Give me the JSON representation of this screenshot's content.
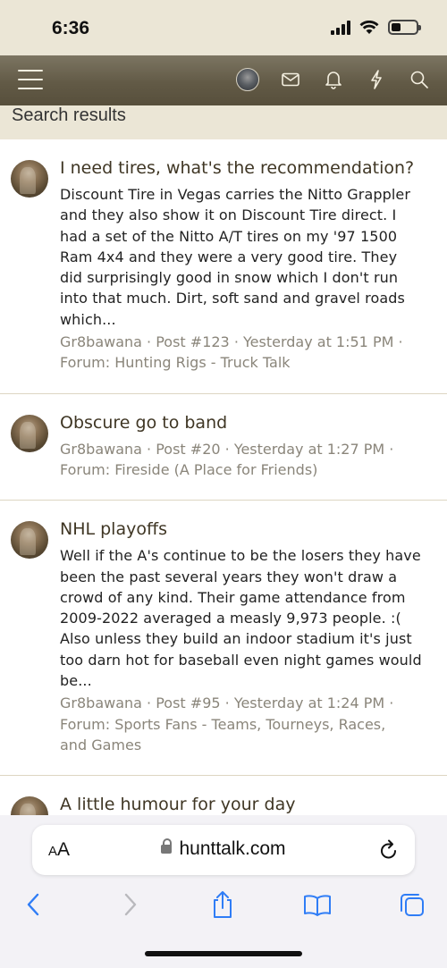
{
  "status_bar": {
    "time": "6:36"
  },
  "header": {
    "menu_icon": "hamburger-icon",
    "icons": [
      "avatar",
      "envelope-icon",
      "bell-icon",
      "lightning-icon",
      "search-icon"
    ]
  },
  "page": {
    "title": "Search results"
  },
  "results": [
    {
      "title": "I need tires, what's the recommendation?",
      "snippet_lines": [
        "Discount Tire in Vegas carries the Nitto Grappler",
        "and they also show it on Discount Tire direct. I",
        "had a set of the Nitto A/T tires on my '97 1500",
        "Ram 4x4 and they were a very good tire. They",
        "did surprisingly good in snow which I don't run",
        "into that much. Dirt, soft sand and gravel roads",
        "which..."
      ],
      "author": "Gr8bawana",
      "post": "Post #123",
      "time": "Yesterday at 1:51 PM",
      "forum": "Forum: Hunting Rigs - Truck Talk"
    },
    {
      "title": "Obscure go to band",
      "snippet_lines": [],
      "author": "Gr8bawana",
      "post": "Post #20",
      "time": "Yesterday at 1:27 PM",
      "forum": "Forum: Fireside (A Place for Friends)"
    },
    {
      "title": "NHL playoffs",
      "snippet_lines": [
        "Well if the A's continue to be the losers they have",
        "been the past several years they won't draw a",
        "crowd of any kind. Their game attendance from",
        "2009-2022 averaged a measly 9,973 people. :(",
        "Also unless they build an indoor stadium it's just",
        "too darn hot for baseball even night games would",
        "be..."
      ],
      "author": "Gr8bawana",
      "post": "Post #95",
      "time": "Yesterday at 1:24 PM",
      "forum_lines": [
        "Forum: Sports Fans - Teams, Tourneys, Races,",
        "and Games"
      ]
    },
    {
      "title": "A little humour for your day"
    }
  ],
  "safari": {
    "aa_big": "A",
    "aa_small": "A",
    "host": "hunttalk.com"
  }
}
